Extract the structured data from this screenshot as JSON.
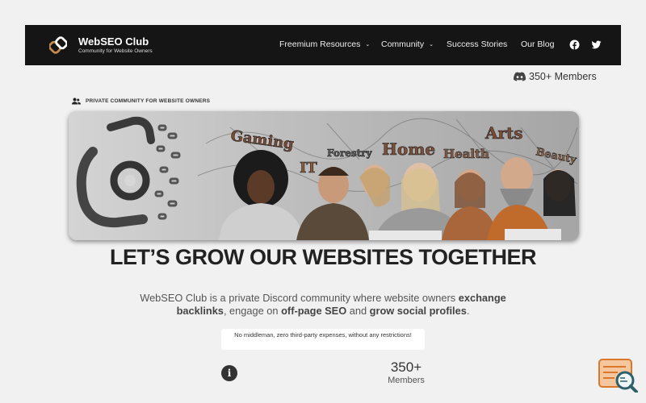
{
  "nav": {
    "brand_name": "WebSEO Club",
    "brand_tagline": "Community for Website Owners",
    "links": [
      {
        "label": "Freemium Resources",
        "dropdown": true
      },
      {
        "label": "Community",
        "dropdown": true
      },
      {
        "label": "Success Stories",
        "dropdown": false
      },
      {
        "label": "Our Blog",
        "dropdown": false
      }
    ],
    "social_icons": [
      "facebook-icon",
      "twitter-icon"
    ]
  },
  "members_badge": {
    "icon": "discord-icon",
    "label": "350+ Members"
  },
  "hero": {
    "kicker": "PRIVATE COMMUNITY FOR WEBSITE OWNERS",
    "banner_words": [
      "Gaming",
      "IT",
      "Forestry",
      "Home",
      "Health",
      "Arts",
      "Beauty"
    ],
    "title": "LET’S GROW OUR WEBSITES TOGETHER",
    "description_pre": "WebSEO Club is a private Discord community where website owners ",
    "description_b1": "exchange backlinks",
    "description_mid1": ", engage on ",
    "description_b2": "off-page SEO",
    "description_mid2": " and ",
    "description_b3": "grow social profiles",
    "description_end": ".",
    "note": "No middleman, zero third-party expenses, without any restrictions!"
  },
  "stats": {
    "value": "350+",
    "label": "Members"
  },
  "colors": {
    "navbar": "#151515",
    "accent": "#d9782b",
    "page_bg": "#f1f1f1"
  }
}
